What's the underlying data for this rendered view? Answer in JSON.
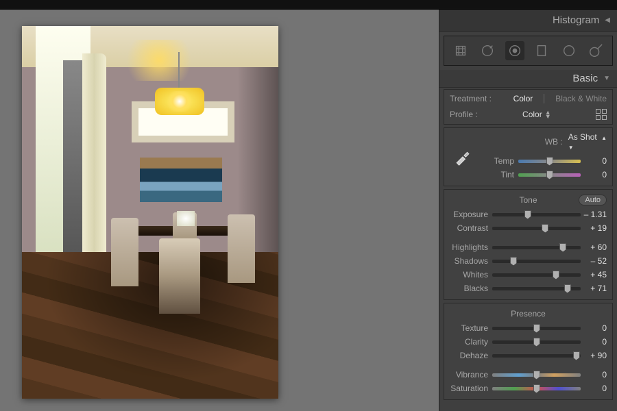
{
  "panel": {
    "histogram_label": "Histogram",
    "basic_label": "Basic",
    "treatment": {
      "label": "Treatment :",
      "color": "Color",
      "bw": "Black & White"
    },
    "profile": {
      "label": "Profile :",
      "value": "Color"
    },
    "wb": {
      "label": "WB :",
      "value": "As Shot",
      "temp_label": "Temp",
      "temp_value": "0",
      "tint_label": "Tint",
      "tint_value": "0"
    },
    "tone": {
      "title": "Tone",
      "auto": "Auto",
      "exposure_label": "Exposure",
      "exposure_value": "– 1.31",
      "contrast_label": "Contrast",
      "contrast_value": "+ 19",
      "highlights_label": "Highlights",
      "highlights_value": "+ 60",
      "shadows_label": "Shadows",
      "shadows_value": "– 52",
      "whites_label": "Whites",
      "whites_value": "+ 45",
      "blacks_label": "Blacks",
      "blacks_value": "+ 71"
    },
    "presence": {
      "title": "Presence",
      "texture_label": "Texture",
      "texture_value": "0",
      "clarity_label": "Clarity",
      "clarity_value": "0",
      "dehaze_label": "Dehaze",
      "dehaze_value": "+ 90",
      "vibrance_label": "Vibrance",
      "vibrance_value": "0",
      "saturation_label": "Saturation",
      "saturation_value": "0"
    }
  },
  "slider_positions": {
    "temp": 50,
    "tint": 50,
    "exposure": 40,
    "contrast": 60,
    "highlights": 80,
    "shadows": 24,
    "whites": 72,
    "blacks": 85,
    "texture": 50,
    "clarity": 50,
    "dehaze": 95,
    "vibrance": 50,
    "saturation": 50
  }
}
